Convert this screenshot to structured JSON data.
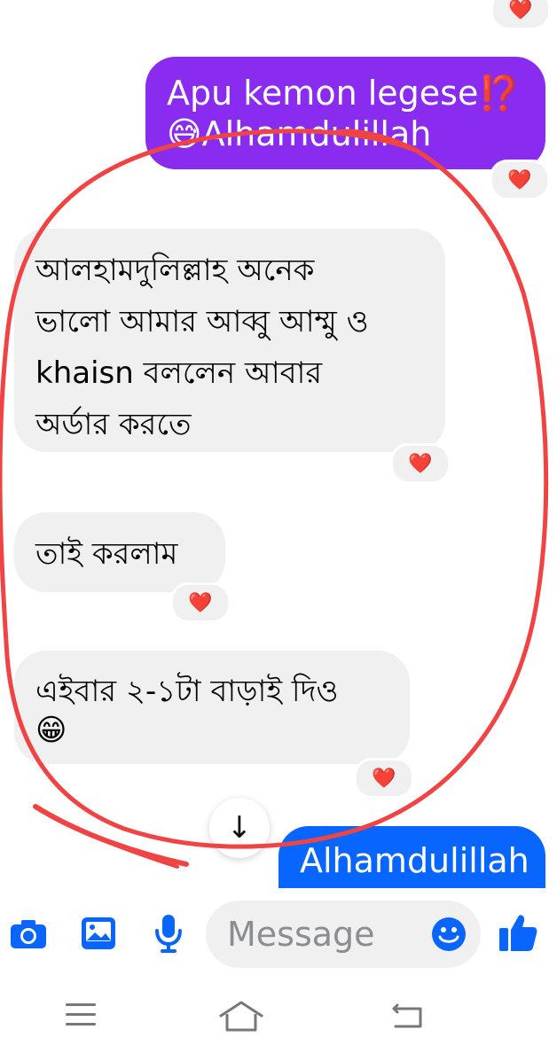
{
  "messages": [
    {
      "id": "out1",
      "side": "out",
      "lines": [
        "Apu kemon legese⁉️",
        "😅Alhamdulillah"
      ],
      "reaction": "❤️"
    },
    {
      "id": "in1",
      "side": "in",
      "lines": [
        "আলহামদুলিল্লাহ অনেক",
        "ভালো আমার আব্বু আম্মু ও",
        "khaisn বললেন আবার",
        "অর্ডার করতে"
      ],
      "reaction": "❤️"
    },
    {
      "id": "in2",
      "side": "in",
      "lines": [
        "তাই করলাম"
      ],
      "reaction": "❤️"
    },
    {
      "id": "in3",
      "side": "in",
      "lines": [
        "এইবার ২-১টা বাড়াই দিও",
        "😁"
      ],
      "reaction": "❤️"
    },
    {
      "id": "out2",
      "side": "out",
      "lines": [
        "Alhamdulillah"
      ]
    }
  ],
  "top_reaction": "❤️",
  "scroll_down_icon": "↓",
  "composer": {
    "placeholder": "Message",
    "icons": [
      "camera-icon",
      "image-icon",
      "mic-icon",
      "emoji-icon",
      "like-icon"
    ]
  },
  "colors": {
    "accent": "#0866ff",
    "outgoing_purple": "#8a2cf0",
    "incoming_bg": "#f0f0f0",
    "heart": "#e41e3f",
    "annotation": "#f04444"
  },
  "system_nav": [
    "menu-icon",
    "home-icon",
    "back-icon"
  ]
}
